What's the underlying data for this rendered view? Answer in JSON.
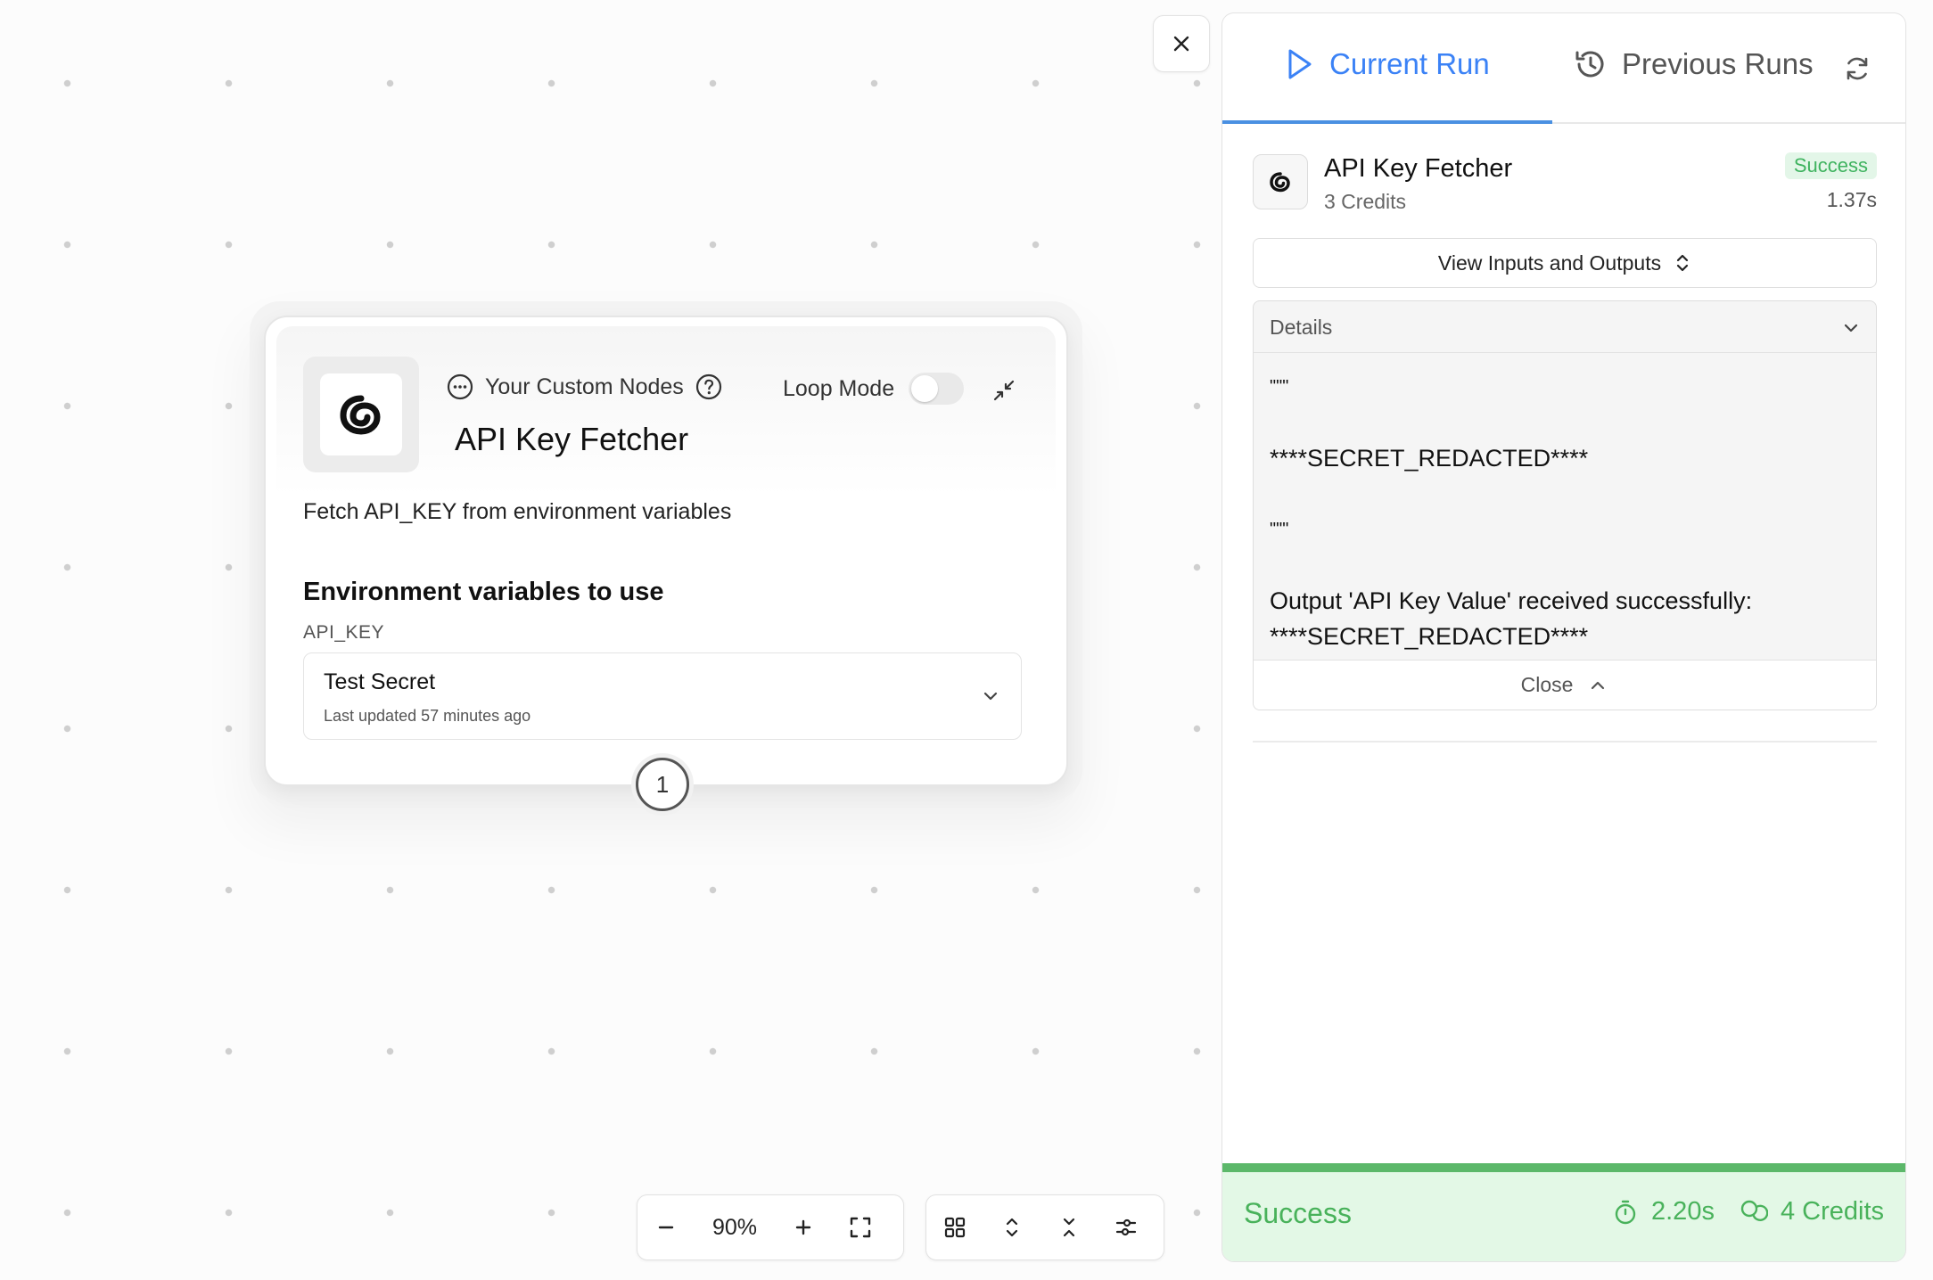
{
  "canvas": {
    "node": {
      "breadcrumb": "Your Custom Nodes",
      "title": "API Key Fetcher",
      "loop_mode_label": "Loop Mode",
      "loop_mode_on": false,
      "description": "Fetch API_KEY from environment variables",
      "env_section_title": "Environment variables to use",
      "env_key": "API_KEY",
      "selected_secret": "Test Secret",
      "secret_updated": "Last updated 57 minutes ago",
      "step_number": "1"
    },
    "zoom": "90%"
  },
  "panel": {
    "tabs": {
      "current": "Current Run",
      "previous": "Previous Runs"
    },
    "run": {
      "name": "API Key Fetcher",
      "credits": "3 Credits",
      "status": "Success",
      "duration": "1.37s"
    },
    "io_button": "View Inputs and Outputs",
    "details": {
      "header": "Details",
      "lines": [
        "\"\"\"",
        "",
        "****SECRET_REDACTED****",
        "",
        "\"\"\"",
        "",
        "Output 'API Key Value' received successfully:",
        "****SECRET_REDACTED****"
      ],
      "close_label": "Close"
    },
    "footer": {
      "status": "Success",
      "time": "2.20s",
      "credits": "4 Credits"
    }
  },
  "colors": {
    "accent_blue": "#3b82f6",
    "success_green": "#49b25b",
    "success_bg": "#e3f8e6"
  }
}
